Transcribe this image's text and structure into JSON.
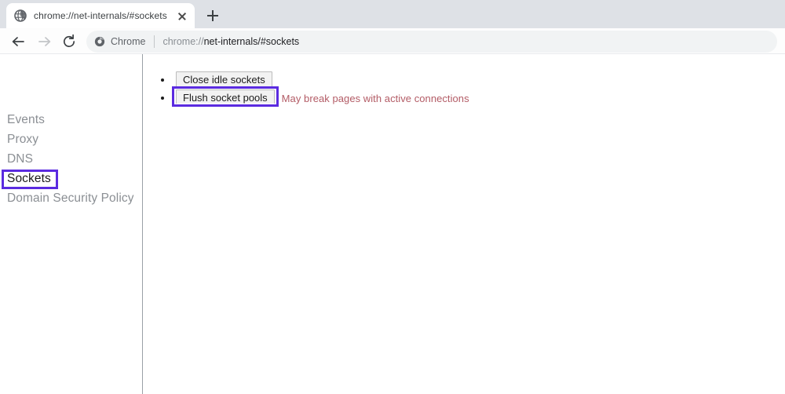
{
  "browser": {
    "tab": {
      "title": "chrome://net-internals/#sockets",
      "favicon_icon": "globe-icon",
      "close_icon": "close-icon"
    },
    "new_tab_icon": "plus-icon",
    "nav": {
      "back_icon": "arrow-left-icon",
      "forward_icon": "arrow-right-icon",
      "reload_icon": "reload-icon"
    },
    "omnibox": {
      "badge_icon": "chrome-icon",
      "badge_label": "Chrome",
      "url_scheme": "chrome://",
      "url_host": "net-internals/#sockets",
      "url_full": "chrome://net-internals/#sockets"
    }
  },
  "sidebar": {
    "items": [
      {
        "label": "Events",
        "selected": false
      },
      {
        "label": "Proxy",
        "selected": false
      },
      {
        "label": "DNS",
        "selected": false
      },
      {
        "label": "Sockets",
        "selected": true
      },
      {
        "label": "Domain Security Policy",
        "selected": false
      }
    ]
  },
  "content": {
    "actions": [
      {
        "label": "Close idle sockets",
        "note": ""
      },
      {
        "label": "Flush socket pools",
        "note": "May break pages with active connections"
      }
    ]
  },
  "annotations": {
    "highlight_color": "#5b2be0",
    "targets": [
      "Sockets",
      "Flush socket pools"
    ]
  },
  "colors": {
    "tabstrip_bg": "#dee1e6",
    "toolbar_bg": "#fdfdfd",
    "omnibox_bg": "#f1f3f4",
    "sidebar_text": "#8b8f94",
    "sidebar_selected_text": "#1b1b1b",
    "warning_text": "#b35c66",
    "button_bg": "#f2f2f2",
    "divider": "#9aa0a6"
  }
}
